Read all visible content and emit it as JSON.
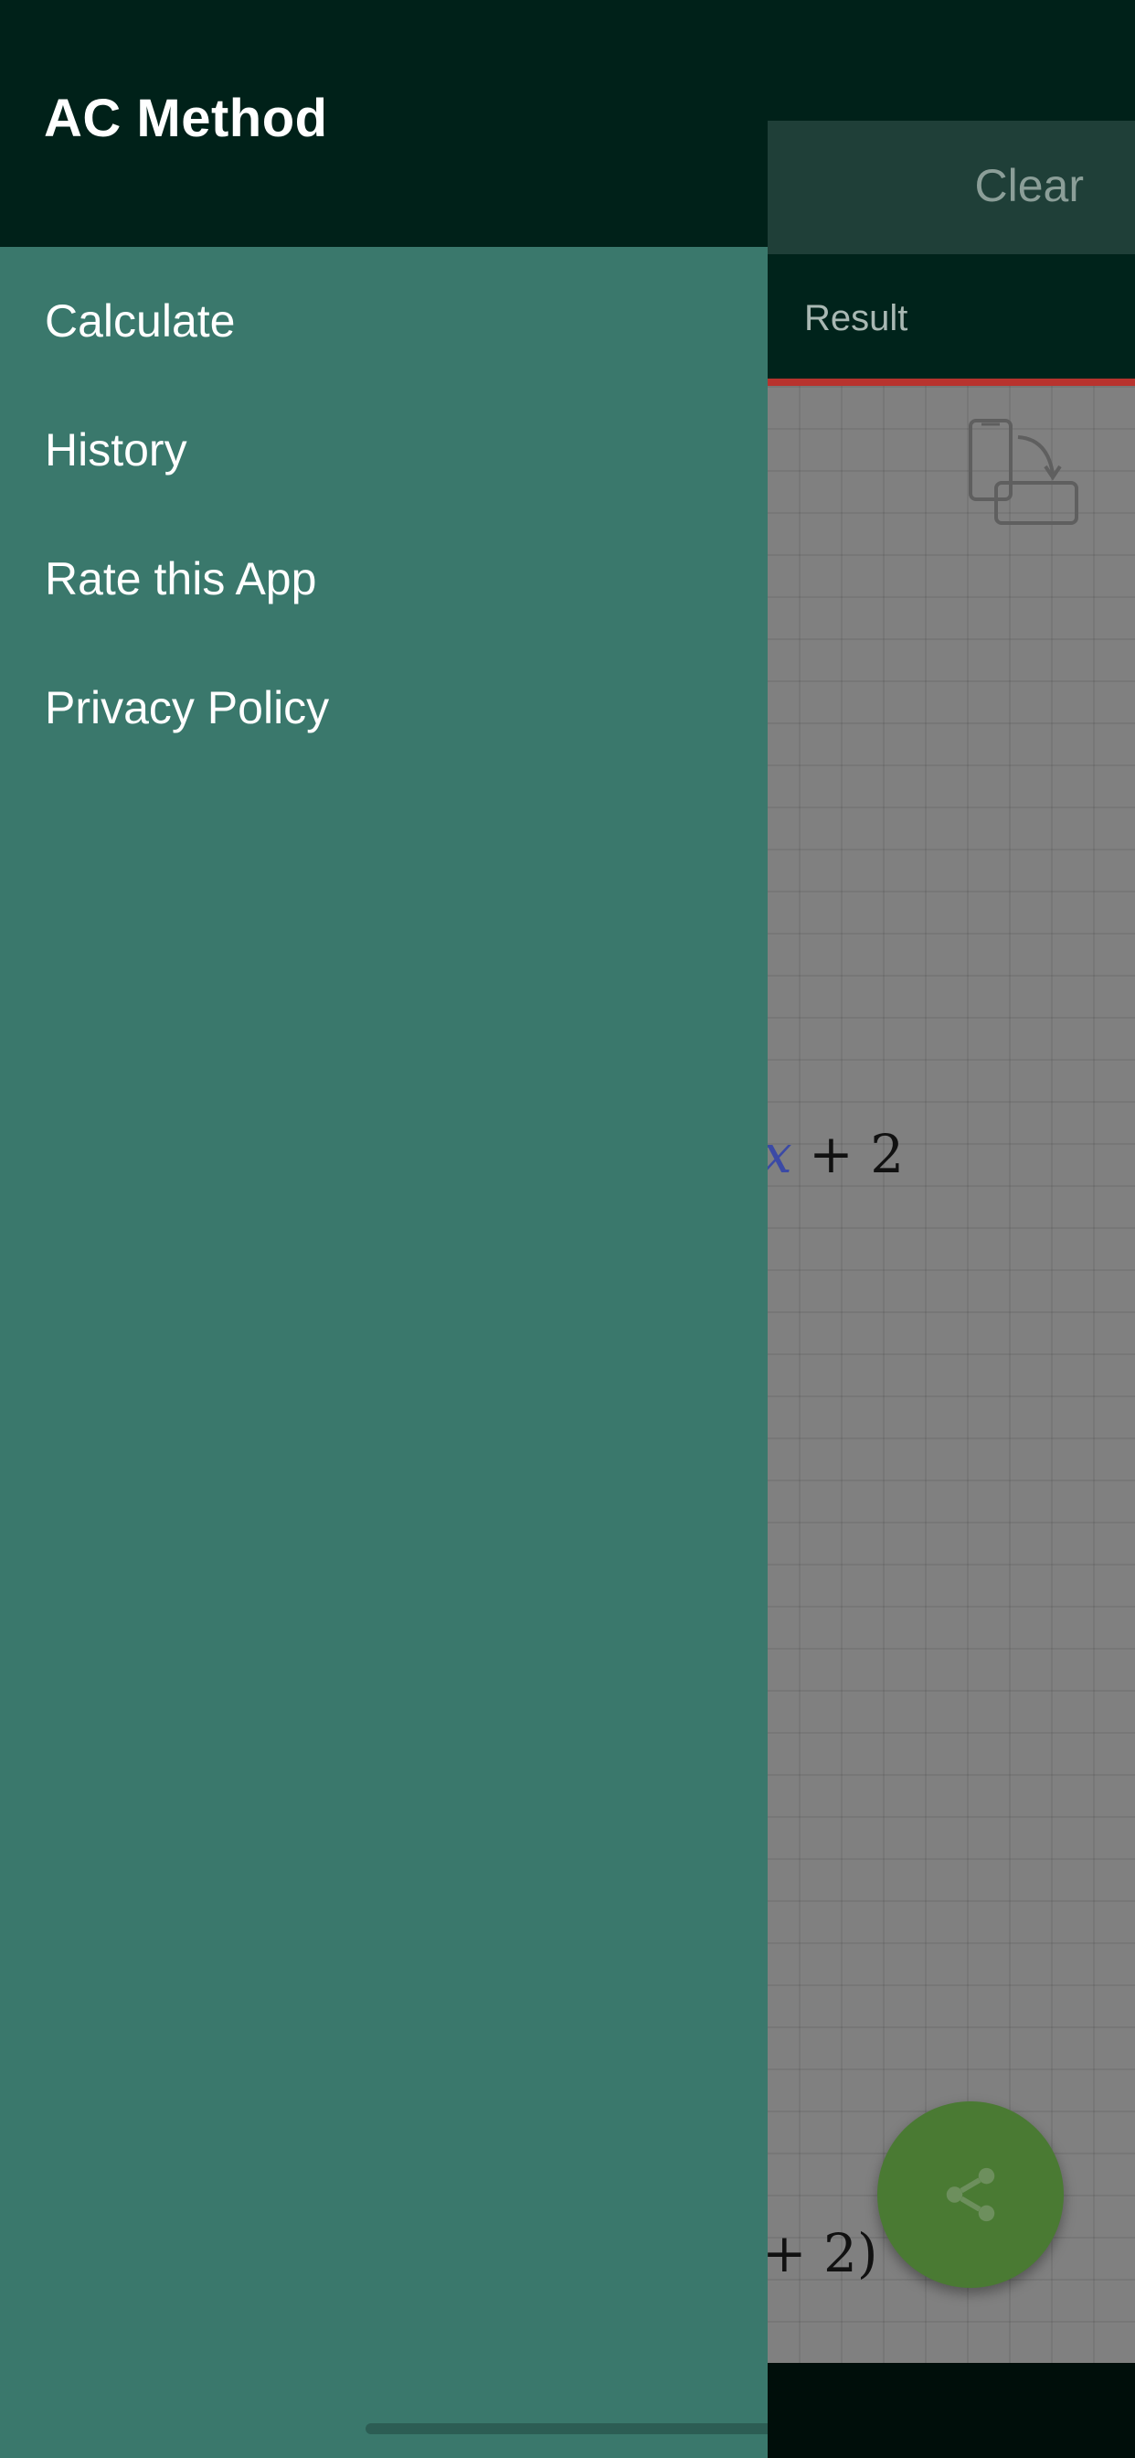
{
  "app": {
    "toolbar": {
      "clear_label": "Clear"
    },
    "tabs": {
      "result_label": "Result"
    },
    "content": {
      "expression_line": {
        "variable": "x",
        "rest": "+ 2"
      },
      "factored_line": {
        "text": "+ 2)"
      }
    },
    "icons": {
      "rotate": "rotate-device-icon",
      "share": "share-icon"
    }
  },
  "drawer": {
    "title": "AC Method",
    "items": [
      {
        "label": "Calculate"
      },
      {
        "label": "History"
      },
      {
        "label": "Rate this App"
      },
      {
        "label": "Privacy Policy"
      }
    ]
  },
  "colors": {
    "drawer_bg": "#3a786c",
    "drawer_header_bg": "#002119",
    "fab": "#4a7a33",
    "tab_indicator": "#b8332e"
  }
}
